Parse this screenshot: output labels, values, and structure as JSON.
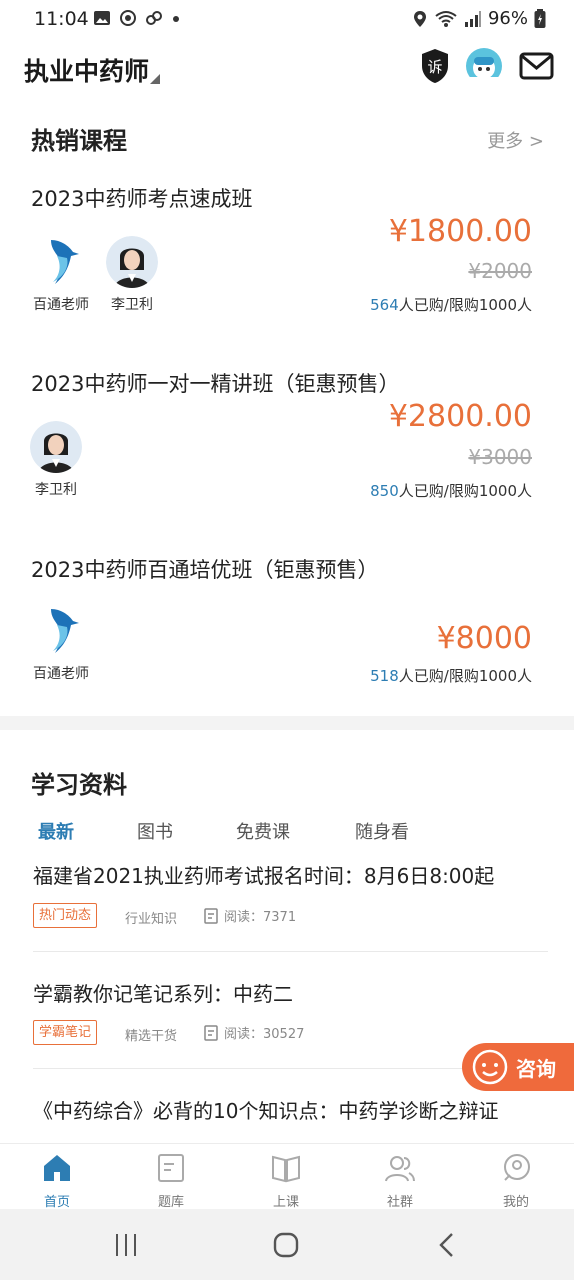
{
  "status_bar": {
    "time": "11:04",
    "battery": "96%"
  },
  "header": {
    "title": "执业中药师"
  },
  "hot_courses": {
    "title": "热销课程",
    "more": "更多 >",
    "courses": [
      {
        "title": "2023中药师考点速成班",
        "price": "¥1800.00",
        "original_price": "¥2000",
        "sold": "564",
        "sold_suffix": "人已购/限购1000人",
        "teachers": [
          {
            "name": "百通老师",
            "avatar": "logo"
          },
          {
            "name": "李卫利",
            "avatar": "person"
          }
        ]
      },
      {
        "title": "2023中药师一对一精讲班（钜惠预售）",
        "price": "¥2800.00",
        "original_price": "¥3000",
        "sold": "850",
        "sold_suffix": "人已购/限购1000人",
        "teachers": [
          {
            "name": "李卫利",
            "avatar": "person"
          }
        ]
      },
      {
        "title": "2023中药师百通培优班（钜惠预售）",
        "price": "¥8000",
        "original_price": "",
        "sold": "518",
        "sold_suffix": "人已购/限购1000人",
        "teachers": [
          {
            "name": "百通老师",
            "avatar": "logo"
          }
        ]
      }
    ]
  },
  "study": {
    "title": "学习资料",
    "tabs": [
      {
        "label": "最新",
        "active": true
      },
      {
        "label": "图书"
      },
      {
        "label": "免费课"
      },
      {
        "label": "随身看"
      }
    ],
    "articles": [
      {
        "title": "福建省2021执业药师考试报名时间：8月6日8:00起",
        "tag": "热门动态",
        "category": "行业知识",
        "reads_label": "阅读：",
        "reads": "7371"
      },
      {
        "title": "学霸教你记笔记系列：中药二",
        "tag": "学霸笔记",
        "category": "精选干货",
        "reads_label": "阅读：",
        "reads": "30527"
      },
      {
        "title": "《中药综合》必背的10个知识点：中药学诊断之辩证"
      }
    ]
  },
  "consult": {
    "label": "咨询"
  },
  "bottom_nav": [
    {
      "label": "首页",
      "icon": "home-icon",
      "active": true
    },
    {
      "label": "题库",
      "icon": "question-bank-icon"
    },
    {
      "label": "上课",
      "icon": "book-icon"
    },
    {
      "label": "社群",
      "icon": "community-icon"
    },
    {
      "label": "我的",
      "icon": "profile-icon"
    }
  ],
  "complaint_badge": "诉",
  "colors": {
    "accent_blue": "#2d7db3",
    "price_orange": "#e8703a",
    "consult_bg": "#ef6a3c"
  }
}
